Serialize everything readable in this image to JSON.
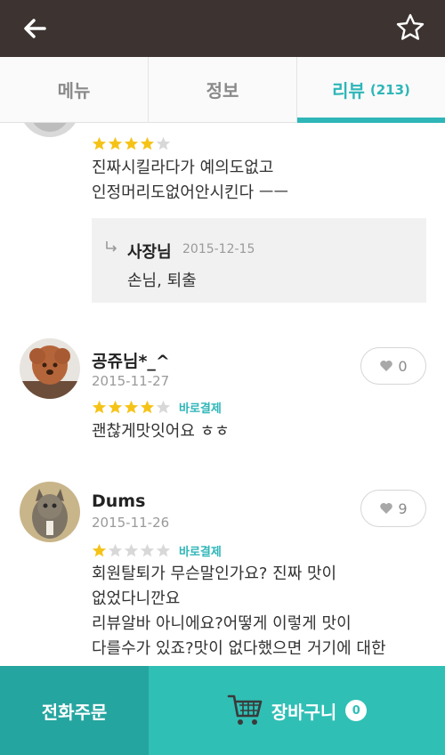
{
  "header": {
    "back_icon": "arrow-left-icon",
    "favorite_icon": "star-outline-icon",
    "background": "#3d3431"
  },
  "tabs": [
    {
      "label": "메뉴",
      "count": ""
    },
    {
      "label": "정보",
      "count": ""
    },
    {
      "label": "리뷰",
      "count": "(213)"
    }
  ],
  "accent_color": "#2fb6b8",
  "reviews": [
    {
      "name": "",
      "date": "",
      "rating": 4,
      "badge": "",
      "text_lines": [
        "진짜시킬라다가 예의도없고",
        "인정머리도없어안시킨다 ㅡㅡ"
      ],
      "reply": {
        "owner": "사장님",
        "date": "2015-12-15",
        "text": "손님, 퇴출"
      }
    },
    {
      "name": "공쥬님*_^",
      "date": "2015-11-27",
      "rating": 4,
      "badge": "바로결제",
      "likes": "0",
      "text_lines": [
        "괜찮게맛잇어요 ㅎㅎ"
      ]
    },
    {
      "name": "Dums",
      "date": "2015-11-26",
      "rating": 1,
      "badge": "바로결제",
      "likes": "9",
      "text_lines": [
        "회원탈퇴가 무슨말인가요? 진짜 맛이",
        "없었다니깐요",
        "리뷰알바 아니에요?어떻게 이렇게 맛이",
        "다를수가 있죠?맛이 없다했으면 거기에 대한"
      ]
    }
  ],
  "bottom": {
    "phone_order_label": "전화주문",
    "cart_label": "장바구니",
    "cart_count": "0",
    "cart_icon": "shopping-cart-icon"
  }
}
